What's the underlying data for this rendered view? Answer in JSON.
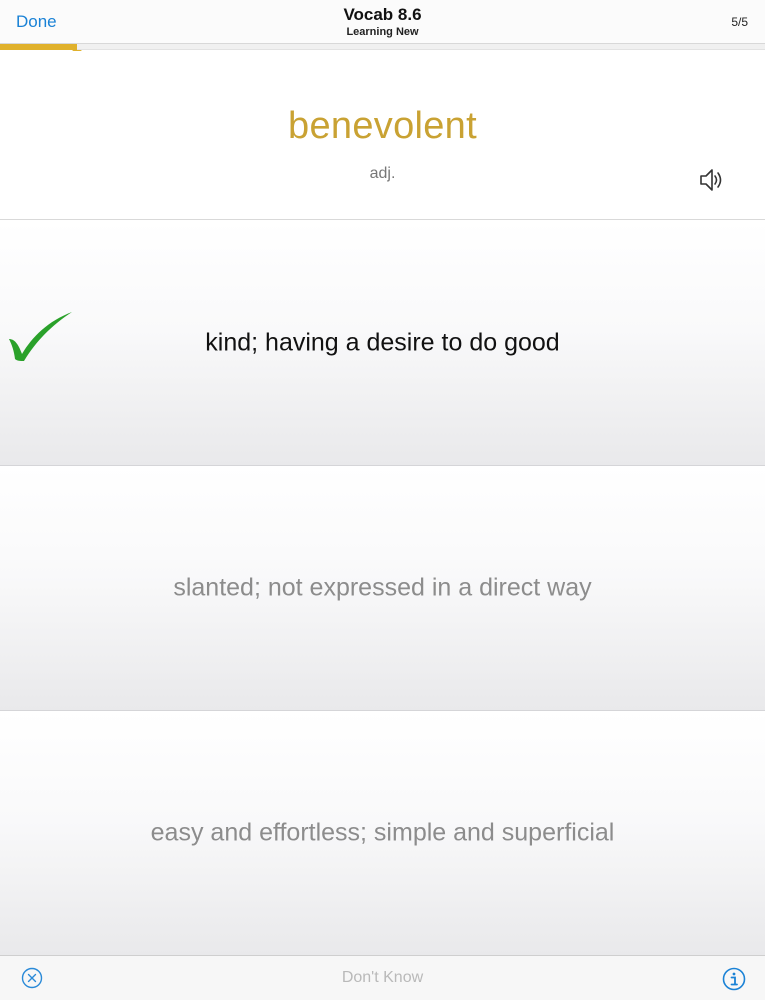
{
  "header": {
    "done_label": "Done",
    "title": "Vocab 8.6",
    "subtitle": "Learning New",
    "counter": "5/5"
  },
  "progress": {
    "fraction": 0.1,
    "color": "#e0b12c"
  },
  "word": {
    "term": "benevolent",
    "part_of_speech": "adj.",
    "color": "#c9a233",
    "speaker_icon": "speaker-icon"
  },
  "options": [
    {
      "text": "kind; having a desire to do good",
      "state": "correct"
    },
    {
      "text": "slanted; not expressed in a direct way",
      "state": "neutral"
    },
    {
      "text": "easy and effortless; simple and superficial",
      "state": "neutral"
    }
  ],
  "footer": {
    "dont_know_label": "Don't Know",
    "left_icon": "close-circle-icon",
    "right_icon": "info-icon"
  },
  "colors": {
    "accent_blue": "#1a82d6",
    "check_green": "#2aa12a"
  }
}
